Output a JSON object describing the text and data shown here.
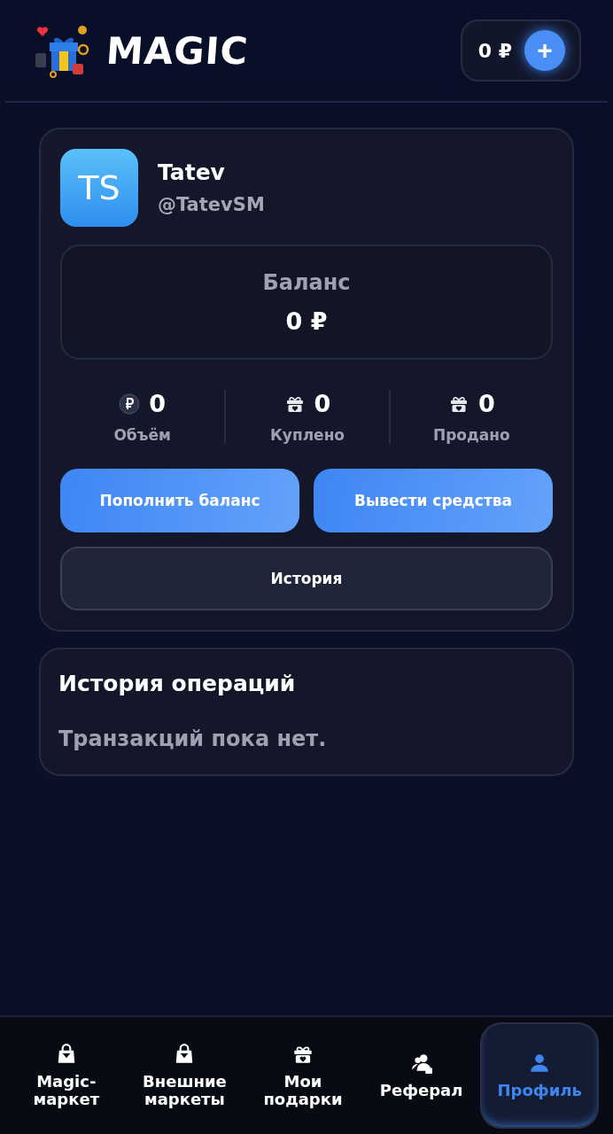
{
  "header": {
    "logo_text": "MAGIC",
    "balance": "0 ₽",
    "add_button": "+"
  },
  "profile": {
    "initials": "TS",
    "name": "Tatev",
    "username": "@TatevSM",
    "balance": {
      "label": "Баланс",
      "amount": "0 ₽"
    },
    "stats": [
      {
        "value": "0",
        "label": "Объём"
      },
      {
        "value": "0",
        "label": "Куплено"
      },
      {
        "value": "0",
        "label": "Продано"
      }
    ],
    "buttons": [
      "Пополнить баланс",
      "Вывести средства"
    ],
    "history_button": "История"
  },
  "operations": {
    "title": "История операций",
    "empty_text": "Транзакций пока нет."
  },
  "bottom_nav": [
    {
      "label": "Magic-маркет",
      "selected": false
    },
    {
      "label": "Внешние маркеты",
      "selected": false
    },
    {
      "label": "Мои подарки",
      "selected": false
    },
    {
      "label": "Реферал",
      "selected": false
    },
    {
      "label": "Профиль",
      "selected": true
    }
  ]
}
